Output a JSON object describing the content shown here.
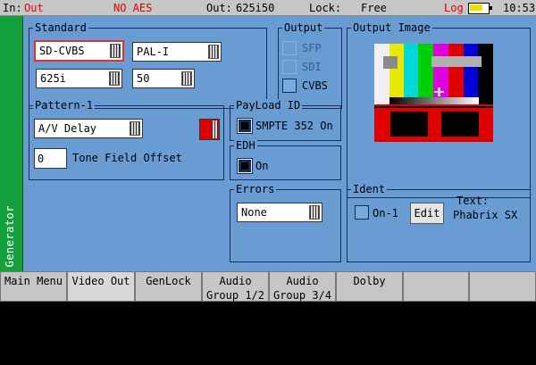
{
  "status": {
    "in_label": "In:",
    "in_value": "Out",
    "audio": "NO AES",
    "out_label": "Out:",
    "out_value": "625i50",
    "lock_label": "Lock:",
    "lock_value": "Free",
    "log": "Log",
    "battery_icon": "battery-icon",
    "time": "10:53"
  },
  "side_tab": "Generator",
  "standard": {
    "title": "Standard",
    "format": "SD-CVBS",
    "color_standard": "PAL-I",
    "lines": "625i",
    "rate": "50"
  },
  "output": {
    "title": "Output",
    "options": [
      {
        "label": "SFP",
        "enabled": false
      },
      {
        "label": "SDI",
        "enabled": false
      },
      {
        "label": "CVBS",
        "enabled": true
      }
    ]
  },
  "output_image": {
    "title": "Output Image"
  },
  "pattern": {
    "title": "Pattern-1",
    "value": "A/V Delay",
    "offset_value": "0",
    "offset_label": "Tone Field Offset"
  },
  "payload": {
    "title": "PayLoad ID",
    "label": "SMPTE 352 On"
  },
  "edh": {
    "title": "EDH",
    "label": "On"
  },
  "errors": {
    "title": "Errors",
    "value": "None"
  },
  "ident": {
    "title": "Ident",
    "on_label": "On-1",
    "edit_label": "Edit",
    "text_label": "Text:",
    "text_value": "Phabrix SX"
  },
  "tabs": [
    {
      "line1": "Main Menu",
      "line2": ""
    },
    {
      "line1": "Video Out",
      "line2": ""
    },
    {
      "line1": "GenLock",
      "line2": ""
    },
    {
      "line1": "Audio",
      "line2": "Group 1/2"
    },
    {
      "line1": "Audio",
      "line2": "Group 3/4"
    },
    {
      "line1": "Dolby",
      "line2": ""
    },
    {
      "line1": "",
      "line2": ""
    },
    {
      "line1": "",
      "line2": ""
    }
  ],
  "colors": {
    "panel": "#6a9cd4",
    "generator_tab": "#14a03c",
    "alert": "#e00000",
    "battery": "#f0e000"
  }
}
